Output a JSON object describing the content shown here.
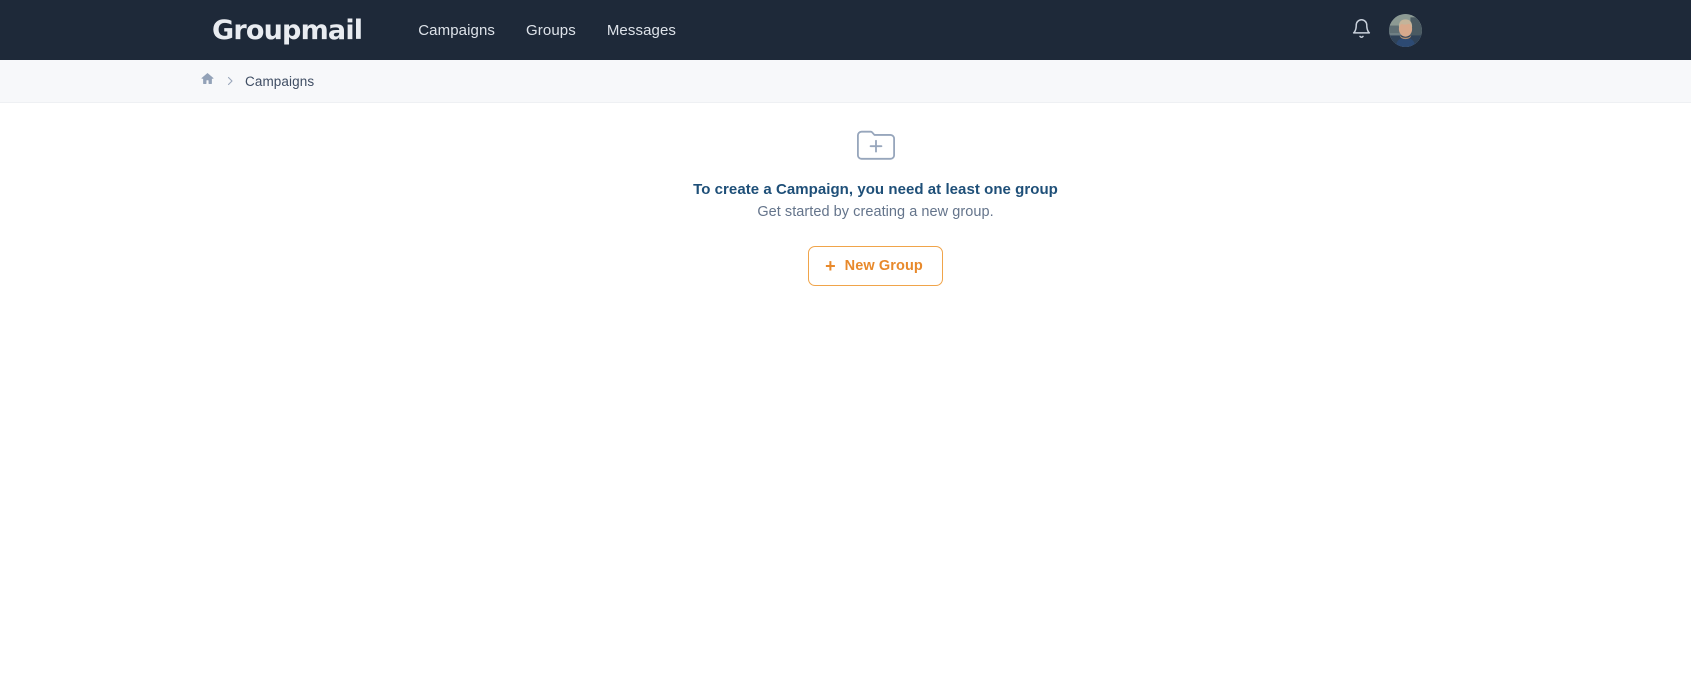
{
  "header": {
    "logo_text": "Groupmail",
    "nav_items": [
      {
        "label": "Campaigns"
      },
      {
        "label": "Groups"
      },
      {
        "label": "Messages"
      }
    ],
    "notifications_icon": "bell-icon",
    "avatar_icon": "user-avatar",
    "background_color": "#1e2939",
    "text_color": "#dde2e9"
  },
  "breadcrumb": {
    "home_icon": "home-icon",
    "separator": "›",
    "current": "Campaigns",
    "background_color": "#f7f8fa"
  },
  "main": {
    "empty_state": {
      "icon": "folder-plus-icon",
      "title": "To create a Campaign, you need at least one group",
      "subtitle": "Get started by creating a new group.",
      "title_color": "#1e4f78",
      "subtitle_color": "#64748b",
      "button": {
        "icon": "plus-icon",
        "plus": "+",
        "label": "New Group",
        "accent_color": "#e8892b",
        "border_color": "#f0a44a"
      }
    }
  }
}
